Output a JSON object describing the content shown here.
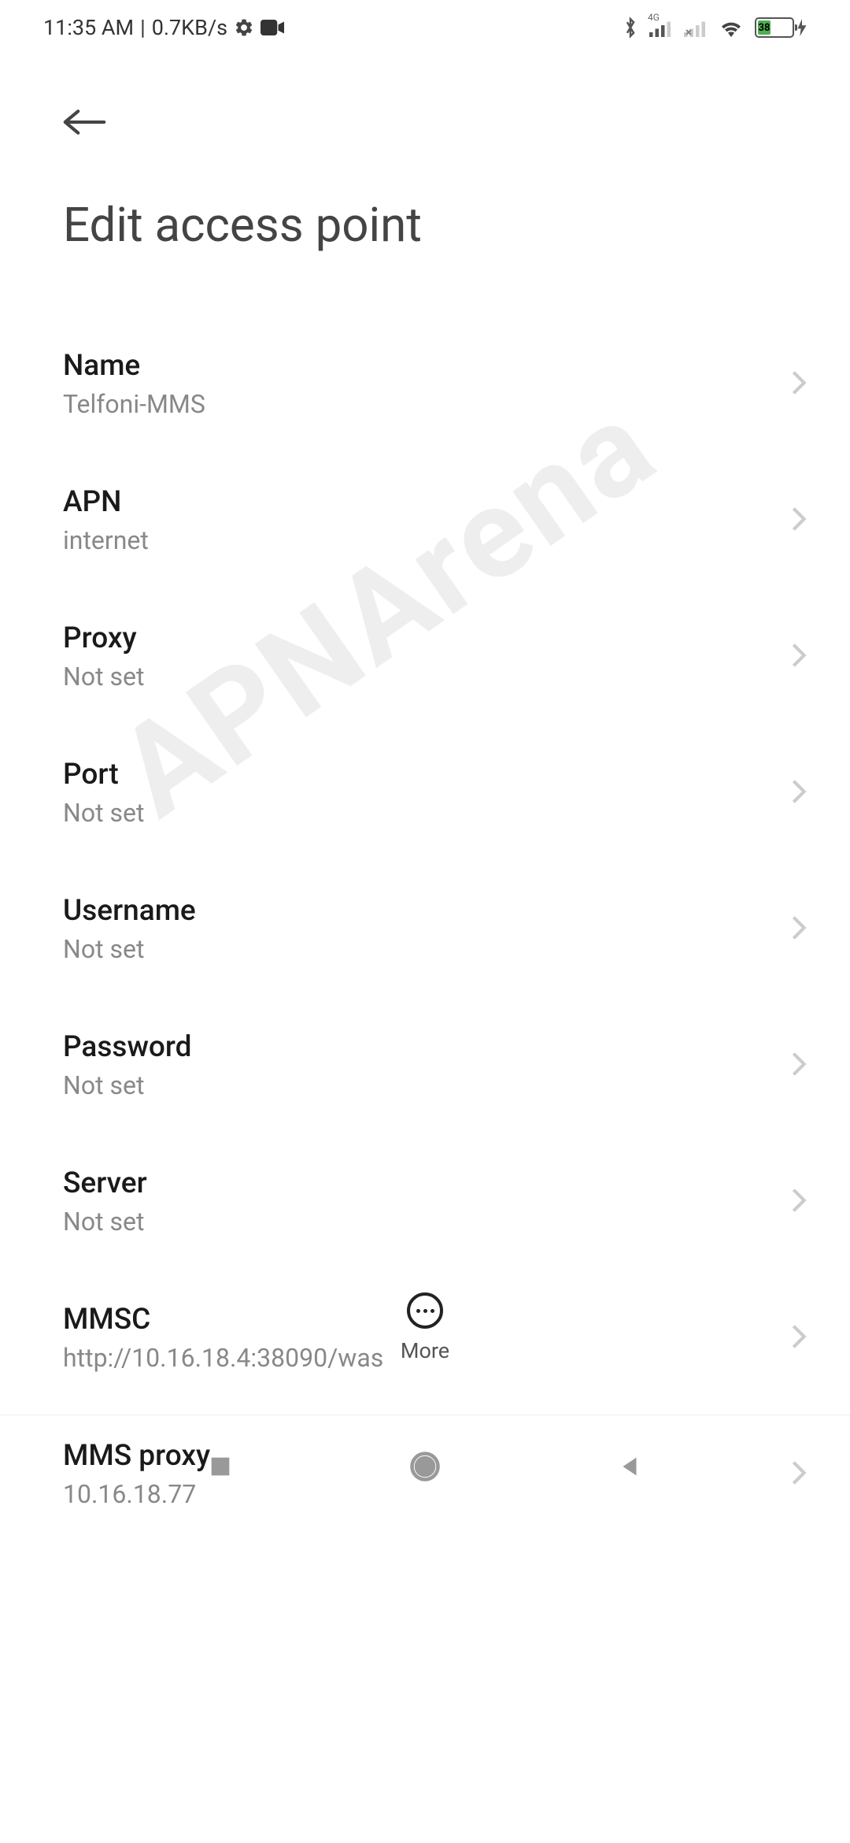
{
  "status_bar": {
    "time": "11:35 AM",
    "data_rate": "0.7KB/s",
    "battery_percent": "38",
    "network_label": "4G"
  },
  "header": {
    "title": "Edit access point"
  },
  "settings": [
    {
      "id": "name",
      "label": "Name",
      "value": "Telfoni-MMS"
    },
    {
      "id": "apn",
      "label": "APN",
      "value": "internet"
    },
    {
      "id": "proxy",
      "label": "Proxy",
      "value": "Not set"
    },
    {
      "id": "port",
      "label": "Port",
      "value": "Not set"
    },
    {
      "id": "username",
      "label": "Username",
      "value": "Not set"
    },
    {
      "id": "password",
      "label": "Password",
      "value": "Not set"
    },
    {
      "id": "server",
      "label": "Server",
      "value": "Not set"
    },
    {
      "id": "mmsc",
      "label": "MMSC",
      "value": "http://10.16.18.4:38090/was"
    },
    {
      "id": "mms-proxy",
      "label": "MMS proxy",
      "value": "10.16.18.77"
    }
  ],
  "bottom_action": {
    "more_label": "More"
  },
  "watermark": "APNArena"
}
